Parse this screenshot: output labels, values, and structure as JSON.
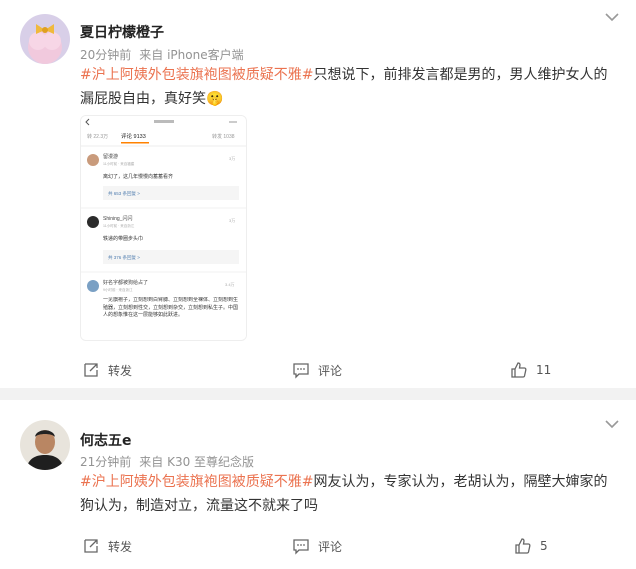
{
  "posts": [
    {
      "user": "夏日柠檬橙子",
      "time": "20分钟前",
      "source": "来自 iPhone客户端",
      "hashtag": "#沪上阿姨外包装旗袍图被质疑不雅#",
      "text": "只想说下，前排发言都是男的，男人维护女人的漏屁股自由，真好笑🤫",
      "actions": {
        "repost": "转发",
        "comment": "评论",
        "like_count": "11"
      },
      "screenshot": {
        "stats_left": "转 22.3万",
        "tab": "评论 9133",
        "stats_right": "转发 1038",
        "comments": [
          {
            "name": "留漫游",
            "meta": "11小时前 · 来自福建",
            "likes": "3万",
            "text": "离幻了，这几年慢慢向蓄蓄看齐",
            "replies": "共 653 条回复 >"
          },
          {
            "name": "Shining_闪闪",
            "meta": "11小时前 · 来自浙江",
            "likes": "3万",
            "text": "轶递的带圈步头巾",
            "replies": "共 376 条回复 >"
          },
          {
            "name": "好名字都被狗给占了",
            "meta": "9小时前 · 来自浙江",
            "likes": "3.4万",
            "text": "一见旗袍子，立刻想到白臂膊、立刻想到全裸体、立刻想到生殖器，立刻想到性交，立刻想到杂交，立刻想到私生子。中国人的想象惟在这一层能够如此跃进。"
          }
        ]
      }
    },
    {
      "user": "何志五e",
      "time": "21分钟前",
      "source": "来自 K30 至尊纪念版",
      "hashtag": "#沪上阿姨外包装旗袍图被质疑不雅#",
      "text": "网友认为，专家认为，老胡认为，隔壁大婶家的狗认为，制造对立，流量这不就来了吗",
      "actions": {
        "repost": "转发",
        "comment": "评论",
        "like_count": "5"
      }
    }
  ],
  "colors": {
    "hashtag": "#eb7350",
    "meta": "#939393",
    "background": "#f2f2f2"
  },
  "icons": [
    "chevron-down-icon",
    "repost-icon",
    "comment-icon",
    "like-icon"
  ]
}
